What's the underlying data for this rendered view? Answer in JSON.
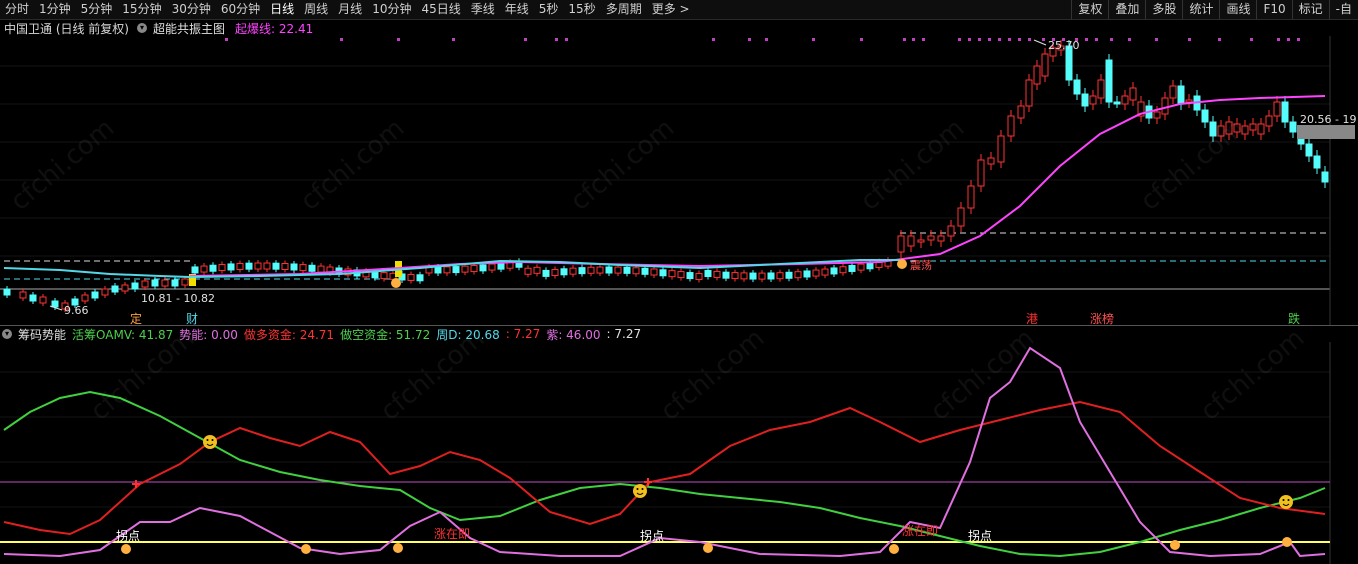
{
  "toolbar": {
    "periods": [
      "分时",
      "1分钟",
      "5分钟",
      "15分钟",
      "30分钟",
      "60分钟",
      "日线",
      "周线",
      "月线",
      "10分钟",
      "45日线",
      "季线",
      "年线",
      "5秒",
      "15秒",
      "多周期",
      "更多 >"
    ],
    "active": "日线",
    "right_items": [
      "复权",
      "叠加",
      "多股",
      "统计",
      "画线",
      "F10",
      "标记",
      "-自"
    ]
  },
  "main_panel": {
    "stock_name": "中国卫通 (日线 前复权)",
    "indicator_name": "超能共振主图",
    "indicator_value_label": "起爆线: 22.41",
    "labels": {
      "high": "25.70",
      "low": "9.66",
      "range": "10.81 - 10.82",
      "price_tag": "20.56 - 19",
      "ding": "定",
      "cai": "财",
      "gang": "港",
      "zhangbang": "涨榜",
      "die": "跌",
      "zhendang": "震荡"
    },
    "colors": {
      "up": "#ff3232",
      "down": "#54fcfc",
      "ma": "#ff44ff",
      "cyan_line": "#54d8e8"
    }
  },
  "sub_panel": {
    "indicator_name": "筹码势能",
    "values": {
      "active_chip": "活筹OAMV: 41.87",
      "momentum": "势能: 0.00",
      "long_fund": "做多资金: 24.71",
      "short_fund": "做空资金: 51.72",
      "week_d": "周D: 20.68",
      "v1": ": 7.27",
      "purple": "紫: 46.00",
      "v2": ": 7.27"
    },
    "labels": {
      "guaidian": "拐点",
      "zhangzaiji": "涨在即"
    }
  },
  "watermark": "cfchi.com"
}
